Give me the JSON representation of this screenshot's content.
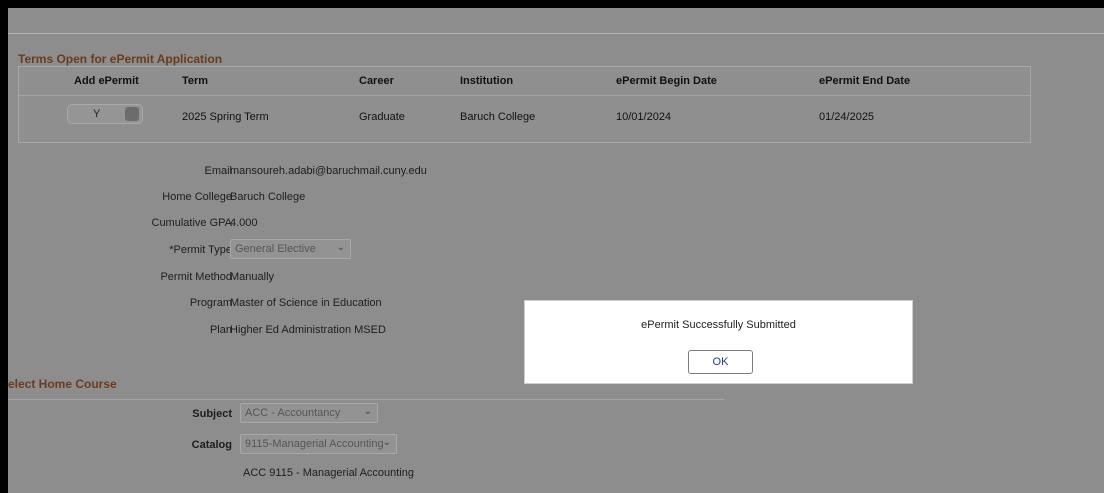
{
  "terms_section": {
    "title": "Terms Open for ePermit Application",
    "headers": [
      "Add ePermit",
      "Term",
      "Career",
      "Institution",
      "ePermit Begin Date",
      "ePermit End Date"
    ],
    "row": {
      "toggle_value": "Y",
      "term": "2025 Spring Term",
      "career": "Graduate",
      "institution": "Baruch College",
      "begin_date": "10/01/2024",
      "end_date": "01/24/2025"
    }
  },
  "student_info": {
    "email_label": "Email",
    "email_value": "mansoureh.adabi@baruchmail.cuny.edu",
    "home_college_label": "Home College",
    "home_college_value": "Baruch College",
    "gpa_label": "Cumulative GPA",
    "gpa_value": "4.000",
    "permit_type_label": "*Permit Type",
    "permit_type_value": "General Elective",
    "permit_method_label": "Permit Method",
    "permit_method_value": "Manually",
    "program_label": "Program",
    "program_value": "Master of Science in Education",
    "plan_label": "Plan",
    "plan_value": "Higher Ed Administration MSED"
  },
  "home_course": {
    "title": "elect Home Course",
    "subject_label": "Subject",
    "subject_value": "ACC - Accountancy",
    "catalog_label": "Catalog",
    "catalog_value": "9115-Managerial Accounting",
    "course_description": "ACC 9115 - Managerial Accounting"
  },
  "dialog": {
    "message": "ePermit Successfully Submitted",
    "ok_label": "OK"
  },
  "icons": {
    "select_chevron": "chevron-down-icon"
  },
  "colors": {
    "overlay_bg": "#8d8d8d",
    "section_title": "#6d3a1d",
    "dialog_bg": "#ffffff",
    "ok_text": "#1d3f7a"
  }
}
